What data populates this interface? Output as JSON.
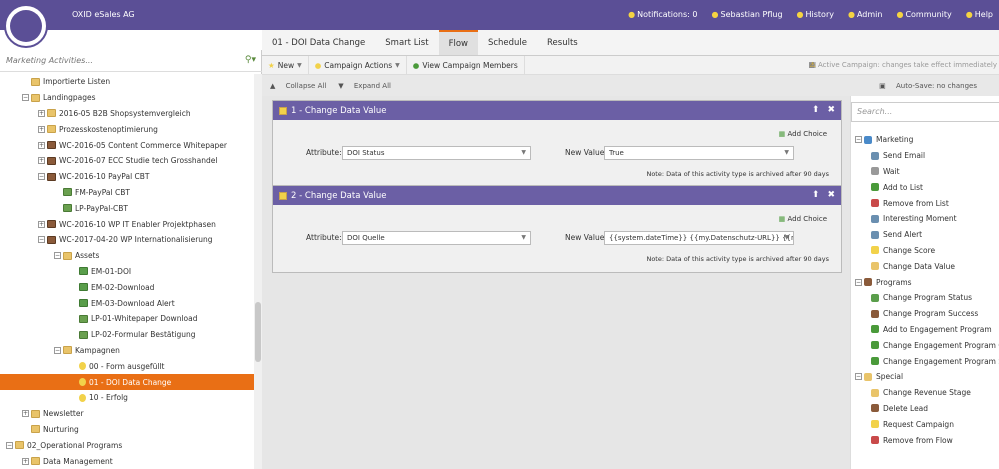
{
  "header": {
    "company": "OXID eSales AG",
    "nav": [
      {
        "label": "Notifications: 0",
        "icon": "bulb-icon"
      },
      {
        "label": "Sebastian Pflug",
        "icon": "user-icon"
      },
      {
        "label": "History",
        "icon": "history-icon"
      },
      {
        "label": "Admin",
        "icon": "gear-icon"
      },
      {
        "label": "Community",
        "icon": "community-icon"
      },
      {
        "label": "Help",
        "icon": "help-icon"
      }
    ]
  },
  "left": {
    "search_placeholder": "Marketing Activities...",
    "tree": [
      {
        "label": "Importierte Listen",
        "indent": 1,
        "icon": "folder",
        "exp": ""
      },
      {
        "label": "Landingpages",
        "indent": 1,
        "icon": "folder",
        "exp": "−"
      },
      {
        "label": "2016-05 B2B Shopsystemvergleich",
        "indent": 2,
        "icon": "folder",
        "exp": "+"
      },
      {
        "label": "Prozesskostenoptimierung",
        "indent": 2,
        "icon": "folder",
        "exp": "+"
      },
      {
        "label": "WC-2016-05 Content Commerce Whitepaper",
        "indent": 2,
        "icon": "prog",
        "exp": "+"
      },
      {
        "label": "WC-2016-07 ECC Studie tech Grosshandel",
        "indent": 2,
        "icon": "prog",
        "exp": "+"
      },
      {
        "label": "WC-2016-10 PayPal CBT",
        "indent": 2,
        "icon": "prog",
        "exp": "−"
      },
      {
        "label": "FM-PayPal CBT",
        "indent": 3,
        "icon": "lp",
        "exp": ""
      },
      {
        "label": "LP-PayPal-CBT",
        "indent": 3,
        "icon": "lp",
        "exp": ""
      },
      {
        "label": "WC-2016-10 WP IT Enabler Projektphasen",
        "indent": 2,
        "icon": "prog",
        "exp": "+"
      },
      {
        "label": "WC-2017-04-20 WP Internationalisierung",
        "indent": 2,
        "icon": "prog",
        "exp": "−"
      },
      {
        "label": "Assets",
        "indent": 3,
        "icon": "folder",
        "exp": "−"
      },
      {
        "label": "EM-01-DOI",
        "indent": 4,
        "icon": "email",
        "exp": ""
      },
      {
        "label": "EM-02-Download",
        "indent": 4,
        "icon": "email",
        "exp": ""
      },
      {
        "label": "EM-03-Download Alert",
        "indent": 4,
        "icon": "email",
        "exp": ""
      },
      {
        "label": "LP-01-Whitepaper Download",
        "indent": 4,
        "icon": "lp",
        "exp": ""
      },
      {
        "label": "LP-02-Formular Bestätigung",
        "indent": 4,
        "icon": "lp",
        "exp": ""
      },
      {
        "label": "Kampagnen",
        "indent": 3,
        "icon": "folder",
        "exp": "−"
      },
      {
        "label": "00 - Form ausgefüllt",
        "indent": 4,
        "icon": "bulb",
        "exp": ""
      },
      {
        "label": "01 - DOI Data Change",
        "indent": 4,
        "icon": "bulb",
        "exp": "",
        "selected": true
      },
      {
        "label": "10 - Erfolg",
        "indent": 4,
        "icon": "bulb",
        "exp": ""
      },
      {
        "label": "Newsletter",
        "indent": 1,
        "icon": "folder",
        "exp": "+"
      },
      {
        "label": "Nurturing",
        "indent": 1,
        "icon": "folder",
        "exp": ""
      },
      {
        "label": "02_Operational Programs",
        "indent": 0,
        "icon": "folder",
        "exp": "−"
      },
      {
        "label": "Data Management",
        "indent": 1,
        "icon": "folder",
        "exp": "+"
      }
    ]
  },
  "tabs": [
    {
      "label": "01 - DOI Data Change",
      "active": false
    },
    {
      "label": "Smart List",
      "active": false
    },
    {
      "label": "Flow",
      "active": true
    },
    {
      "label": "Schedule",
      "active": false
    },
    {
      "label": "Results",
      "active": false
    }
  ],
  "toolbar": {
    "new_label": "New",
    "campaign_actions_label": "Campaign Actions",
    "view_members_label": "View Campaign Members",
    "active_notice": "Active Campaign: changes take effect immediately",
    "collapse_label": "Collapse All",
    "expand_label": "Expand All",
    "autosave_label": "Auto-Save: no changes"
  },
  "steps": [
    {
      "title": "1 - Change Data Value",
      "add_choice": "Add Choice",
      "attribute_label": "Attribute:",
      "attribute_value": "DOI Status",
      "new_value_label": "New Value:",
      "new_value": "True",
      "note": "Note: Data of this activity type is archived after 90 days"
    },
    {
      "title": "2 - Change Data Value",
      "add_choice": "Add Choice",
      "attribute_label": "Attribute:",
      "attribute_value": "DOI Quelle",
      "new_value_label": "New Value:",
      "new_value": "{{system.dateTime}} {{my.Datenschutz-URL}} {{my.",
      "note": "Note: Data of this activity type is archived after 90 days"
    }
  ],
  "palette": {
    "search_placeholder": "Search...",
    "items": [
      {
        "label": "Marketing",
        "type": "cat",
        "color": "#4a8ac9"
      },
      {
        "label": "Send Email",
        "type": "item",
        "color": "#6a8fb0"
      },
      {
        "label": "Wait",
        "type": "item",
        "color": "#999999"
      },
      {
        "label": "Add to List",
        "type": "item",
        "color": "#4a9a3a"
      },
      {
        "label": "Remove from List",
        "type": "item",
        "color": "#c94a4a"
      },
      {
        "label": "Interesting Moment",
        "type": "item",
        "color": "#6a8fb0"
      },
      {
        "label": "Send Alert",
        "type": "item",
        "color": "#6a8fb0"
      },
      {
        "label": "Change Score",
        "type": "item",
        "color": "#f2d24a"
      },
      {
        "label": "Change Data Value",
        "type": "item",
        "color": "#e9c46a"
      },
      {
        "label": "Programs",
        "type": "cat",
        "color": "#8a5a3a"
      },
      {
        "label": "Change Program Status",
        "type": "item",
        "color": "#5a9e4b"
      },
      {
        "label": "Change Program Success",
        "type": "item",
        "color": "#8a5a3a"
      },
      {
        "label": "Add to Engagement Program",
        "type": "item",
        "color": "#4a9a3a"
      },
      {
        "label": "Change Engagement Program Cadence",
        "type": "item",
        "color": "#4a9a3a"
      },
      {
        "label": "Change Engagement Program Stream",
        "type": "item",
        "color": "#4a9a3a"
      },
      {
        "label": "Special",
        "type": "cat",
        "color": "#e9c46a"
      },
      {
        "label": "Change Revenue Stage",
        "type": "item",
        "color": "#e9c46a"
      },
      {
        "label": "Delete Lead",
        "type": "item",
        "color": "#8a5a3a"
      },
      {
        "label": "Request Campaign",
        "type": "item",
        "color": "#f2d24a"
      },
      {
        "label": "Remove from Flow",
        "type": "item",
        "color": "#c94a4a"
      }
    ]
  }
}
